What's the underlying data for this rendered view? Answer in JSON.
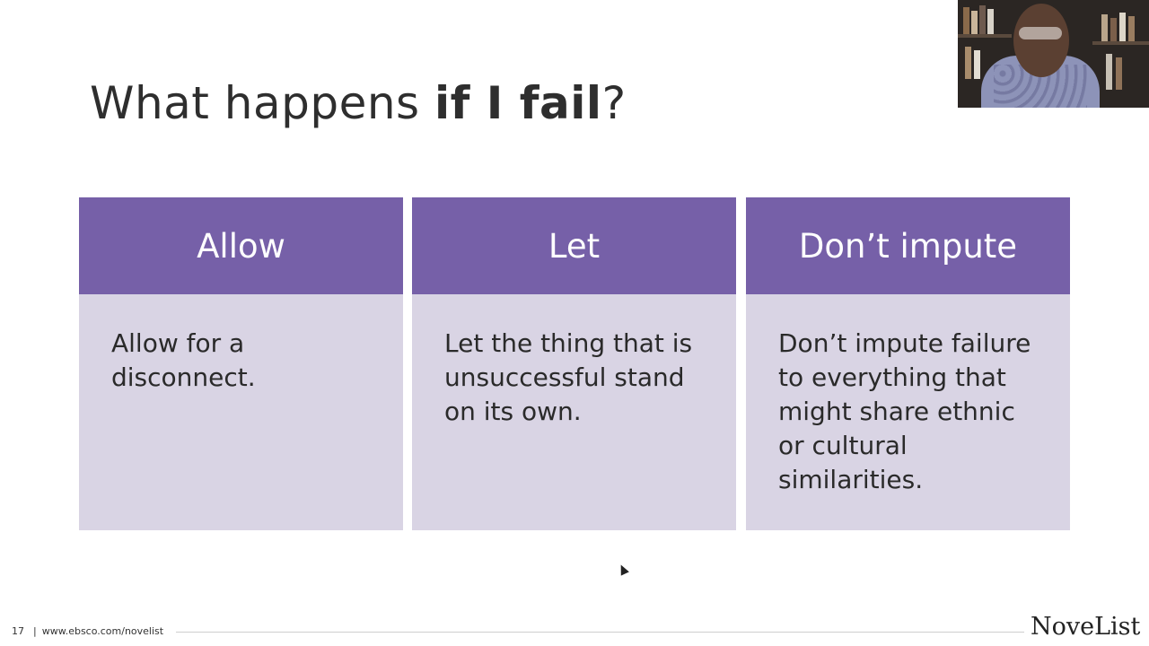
{
  "slide": {
    "title_plain": "What happens ",
    "title_bold": "if I fail",
    "title_end": "?",
    "cards": [
      {
        "heading": "Allow",
        "body": "Allow for a disconnect."
      },
      {
        "heading": "Let",
        "body": "Let the thing that is unsuccessful stand on its own."
      },
      {
        "heading": "Don’t impute",
        "body": "Don’t impute failure to everything that might share ethnic or cultural similarities."
      }
    ]
  },
  "footer": {
    "page_number": "17",
    "separator": "|",
    "url": "www.ebsco.com/novelist"
  },
  "brand": {
    "logo_text": "NoveList"
  },
  "colors": {
    "header_purple": "#7660a8",
    "card_lavender": "#d9d4e4",
    "title_text": "#2e2e2e"
  },
  "icons": {
    "cursor": "mouse-pointer-icon"
  }
}
